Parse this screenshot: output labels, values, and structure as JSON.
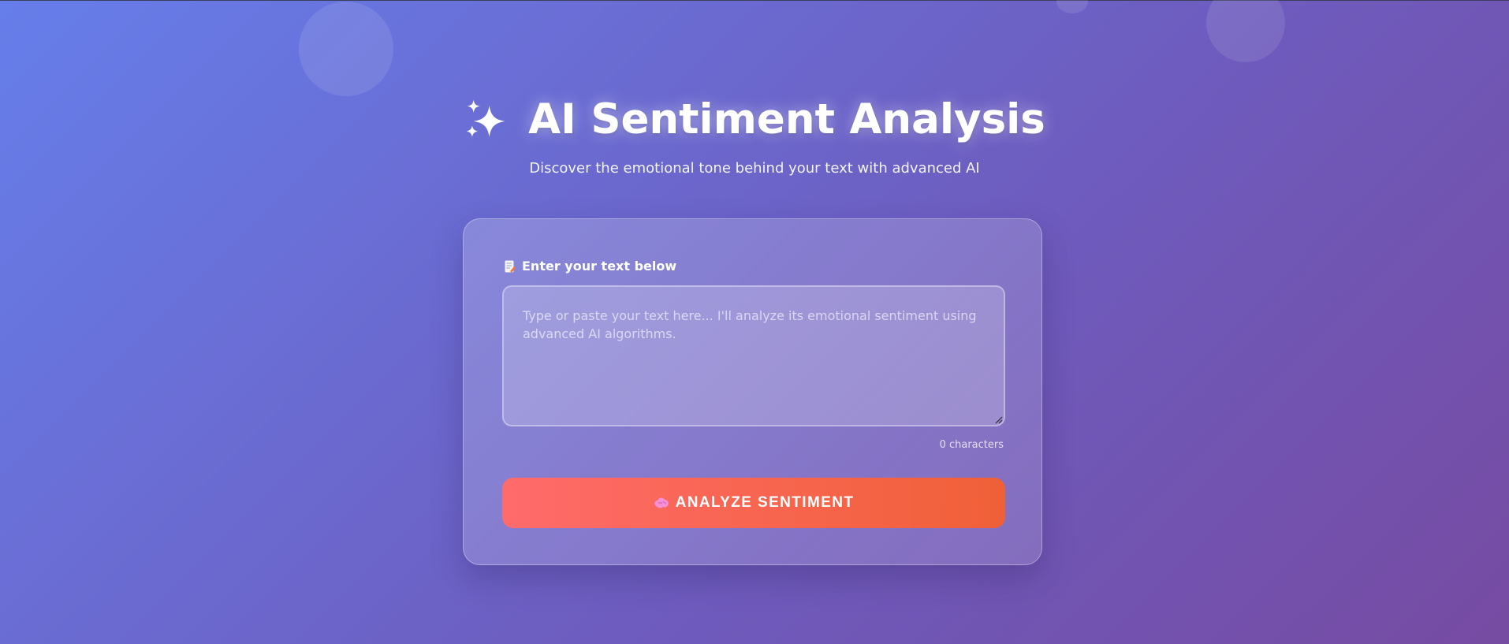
{
  "header": {
    "title": "AI Sentiment Analysis",
    "subtitle": "Discover the emotional tone behind your text with advanced AI",
    "icon": "sparkles-icon"
  },
  "form": {
    "label": "Enter your text below",
    "label_icon": "memo-icon",
    "textarea": {
      "value": "",
      "placeholder": "Type or paste your text here... I'll analyze its emotional sentiment using advanced AI algorithms."
    },
    "char_count": "0 characters",
    "analyze_button": {
      "label": "ANALYZE SENTIMENT",
      "icon": "brain-icon"
    }
  },
  "colors": {
    "background_start": "#667eea",
    "background_end": "#764ba2",
    "button_start": "#ff6b6b",
    "button_end": "#f06037"
  }
}
